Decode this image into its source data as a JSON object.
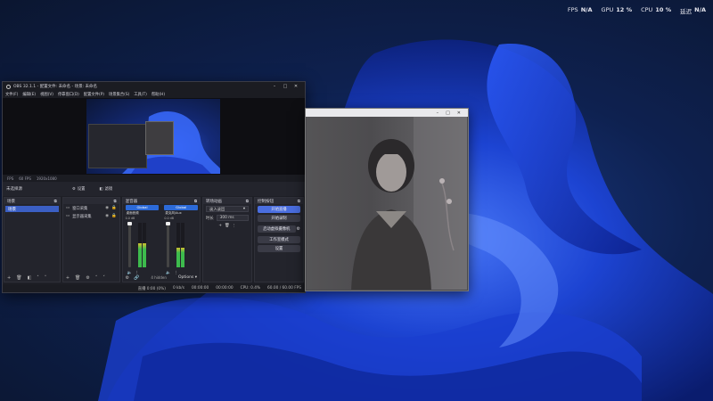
{
  "overlay": {
    "fps_label": "FPS",
    "fps_value": "N/A",
    "gpu_label": "GPU",
    "gpu_value": "12 %",
    "cpu_label": "CPU",
    "cpu_value": "10 %",
    "latency_label": "延迟",
    "latency_value": "N/A"
  },
  "obs": {
    "title": "OBS 32.1.1 - 配置文件: 未命名 - 场景: 未命名",
    "menu": [
      "文件(F)",
      "编辑(E)",
      "视图(V)",
      "停靠窗口(D)",
      "配置文件(P)",
      "场景集合(S)",
      "工具(T)",
      "帮助(H)"
    ],
    "preview_bar": [
      "FPS",
      "60 FPS",
      "1920x1080"
    ],
    "source_toolbar": {
      "label": "未选择源",
      "properties": "设置",
      "filters": "滤镜"
    },
    "scenes": {
      "header": "场景",
      "items": [
        "场景"
      ]
    },
    "sources": {
      "header": "",
      "items": [
        {
          "name": "窗口采集"
        },
        {
          "name": "显示器采集"
        }
      ]
    },
    "mixer": {
      "header": "混音器",
      "channels": [
        {
          "name": "Global",
          "device": "桌面音频",
          "db": "0.0 dB",
          "level": 0.55
        },
        {
          "name": "Global",
          "device": "麦克风/Aux",
          "db": "0.0 dB",
          "level": 0.45
        }
      ],
      "hidden": "4 hidden",
      "options": "Options"
    },
    "transitions": {
      "header": "转场动画",
      "selected": "淡入淡出",
      "duration_label": "时长",
      "duration_value": "300 ms"
    },
    "controls": {
      "header": "控制按钮",
      "buttons": [
        "开始直播",
        "开始录制",
        "启动虚拟摄像机",
        "工作室模式",
        "设置"
      ]
    },
    "status": [
      "直播 0:00 (0%)",
      "0 kb/s",
      "00:00:00",
      "00:00:00",
      "CPU: 0.4%",
      "60.00 / 60.00 FPS"
    ]
  },
  "colors": {
    "accent": "#4a6ee0",
    "scene_select": "#3b5fc4"
  }
}
